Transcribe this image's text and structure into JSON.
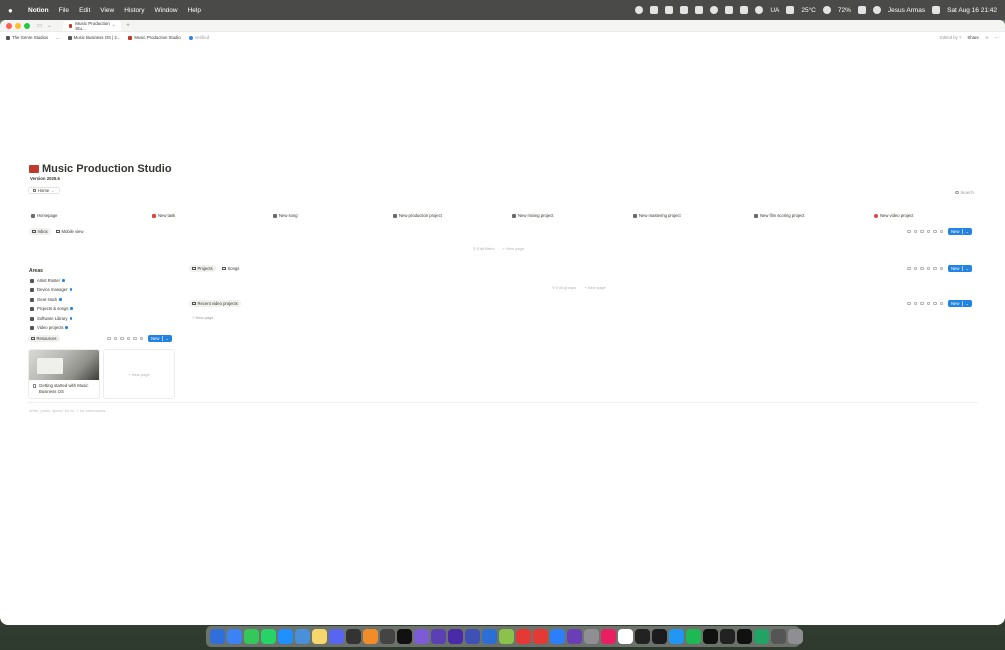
{
  "menubar": {
    "app": "Notion",
    "menus": [
      "File",
      "Edit",
      "View",
      "History",
      "Window",
      "Help"
    ],
    "tray_text": {
      "lang": "UA",
      "weather": "25°C",
      "battery": "72%",
      "user": "Jesus Armas",
      "datetime": "Sat Aug 16  21:42"
    }
  },
  "browser": {
    "tab_title": "Music Production Stu...",
    "breadcrumbs": [
      "The Genre Studios",
      "...",
      "Music Business OS | 2...",
      "Music Production Studio",
      "Verified"
    ],
    "edited_by": "Edited by ?",
    "share_label": "Share"
  },
  "page": {
    "title": "Music Production Studio",
    "version": "Version 2025.6",
    "home_chip": "Home",
    "search_label": "Search",
    "quick_actions": [
      "Homepage",
      "New task",
      "New song",
      "New production project",
      "New mixing project",
      "New mastering project",
      "New film scoring project",
      "New video project"
    ],
    "views": [
      "Inbox",
      "Mobile view"
    ],
    "new_label": "New",
    "inbox_empty": {
      "edit_filters": "Edit filters",
      "new_page": "New page"
    },
    "areas": {
      "heading": "Areas",
      "items": [
        "Artist Roster",
        "Device manager",
        "Gear stock",
        "Projects & songs",
        "Software Library",
        "Video projects"
      ]
    },
    "resources": {
      "tab": "Resources",
      "card_title": "Getting started with Music Business OS",
      "new_page": "New page"
    },
    "projects_tabs": [
      "Projects",
      "Songs"
    ],
    "projects_empty": {
      "edit_groups": "Edit groups",
      "new_page": "New page"
    },
    "recent_video_tab": "Recent video projects",
    "recent_video_new_page": "New page",
    "write_hint": "Write, press 'space' for AI, '/' for commands...",
    "help": "?"
  },
  "colors": {
    "accent": "#2383e2",
    "title_emoji": "#c0392b"
  }
}
